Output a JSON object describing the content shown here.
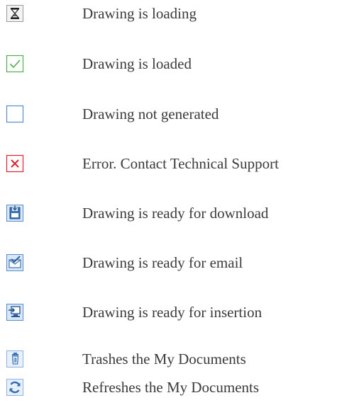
{
  "legend": {
    "items": [
      {
        "icon": "hourglass-icon",
        "label": "Drawing is loading"
      },
      {
        "icon": "checkmark-icon",
        "label": "Drawing is loaded"
      },
      {
        "icon": "empty-box-icon",
        "label": "Drawing not generated"
      },
      {
        "icon": "error-x-icon",
        "label": "Error. Contact Technical Support"
      },
      {
        "icon": "download-floppy-icon",
        "label": "Drawing is ready for download"
      },
      {
        "icon": "email-envelope-icon",
        "label": "Drawing is ready for email"
      },
      {
        "icon": "insert-monitor-icon",
        "label": "Drawing is ready for insertion"
      },
      {
        "icon": "trash-can-icon",
        "label": "Trashes the My Documents"
      },
      {
        "icon": "refresh-arrows-icon",
        "label": "Refreshes the My Documents"
      }
    ]
  },
  "colors": {
    "text": "#3b3b3b",
    "check_green": "#4bb14b",
    "error_red": "#e0202a",
    "blue_frame": "#5b8cc8",
    "blue_fill": "#d9e8f8"
  }
}
